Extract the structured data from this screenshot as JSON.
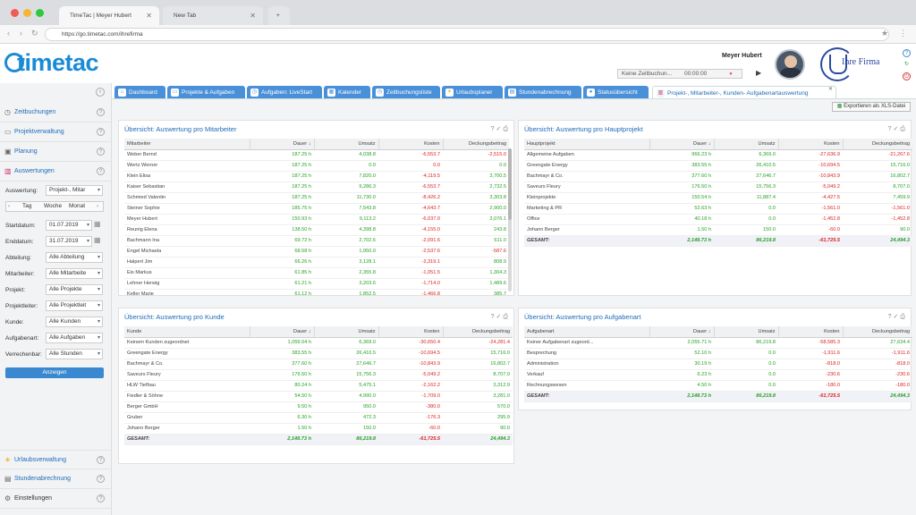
{
  "browser": {
    "tabs": [
      "TimeTac | Meyer Hubert",
      "New Tab"
    ],
    "url": "https://go.timetac.com/ihrefirma"
  },
  "header": {
    "logo": "timetac",
    "user_name": "Meyer Hubert",
    "tracker_text": "Keine Zeitbuchun...",
    "tracker_time": "00:00:00",
    "company_name": "Ihre Firma"
  },
  "sidebar": {
    "items": [
      {
        "label": "Zeitbuchungen",
        "icon": "clock-icon"
      },
      {
        "label": "Projektverwaltung",
        "icon": "folder-icon"
      },
      {
        "label": "Planung",
        "icon": "calendar-check-icon"
      },
      {
        "label": "Auswertungen",
        "icon": "bar-chart-icon"
      }
    ],
    "bottom_items": [
      {
        "label": "Urlaubsverwaltung",
        "icon": "sun-icon"
      },
      {
        "label": "Stundenabrechnung",
        "icon": "document-icon"
      },
      {
        "label": "Einstellungen",
        "icon": "gear-icon"
      }
    ],
    "filters": {
      "auswertung_label": "Auswertung:",
      "auswertung_value": "Projekt-, Mitar",
      "period_buttons": [
        "Tag",
        "Woche",
        "Monat"
      ],
      "startdatum_label": "Startdatum:",
      "startdatum_value": "01.07.2019",
      "enddatum_label": "Enddatum:",
      "enddatum_value": "31.07.2019",
      "abteilung_label": "Abteilung:",
      "abteilung_value": "Alle Abteilung",
      "mitarbeiter_label": "Mitarbeiter:",
      "mitarbeiter_value": "Alle Mitarbeite",
      "projekt_label": "Projekt:",
      "projekt_value": "Alle Projekte",
      "projektleiter_label": "Projektleiter:",
      "projektleiter_value": "Alle Projektleit",
      "kunde_label": "Kunde:",
      "kunde_value": "Alle Kunden",
      "aufgabenart_label": "Aufgabenart:",
      "aufgabenart_value": "Alle Aufgaben",
      "verrechenbar_label": "Verrechenbar:",
      "verrechenbar_value": "Alle Stunden",
      "anzeigen_label": "Anzeigen"
    }
  },
  "tabs": [
    {
      "label": "Dashboard"
    },
    {
      "label": "Projekte & Aufgaben"
    },
    {
      "label": "Aufgaben: LiveStart"
    },
    {
      "label": "Kalender"
    },
    {
      "label": "Zeitbuchungsliste"
    },
    {
      "label": "Urlaubsplaner"
    },
    {
      "label": "Stundenabrechnung"
    },
    {
      "label": "Statusübersicht"
    },
    {
      "label": "Projekt-, Mitarbeiter-, Kunden- Aufgabenartauswertung"
    }
  ],
  "export_label": "Exportieren als XLS-Datei",
  "panels": {
    "mitarbeiter": {
      "title": "Übersicht: Auswertung pro Mitarbeiter",
      "headers": [
        "Mitarbeiter",
        "Dauer ↓",
        "Umsatz",
        "Kosten",
        "Deckungsbeitrag"
      ],
      "rows": [
        [
          "Weber Bernd",
          "187.25 h",
          "4,038.8",
          "-6,553.7",
          "-2,515.0"
        ],
        [
          "Wertz Werner",
          "187.25 h",
          "0.0",
          "0.0",
          "0.0"
        ],
        [
          "Klein Elisa",
          "187.25 h",
          "7,820.0",
          "-4,119.5",
          "3,700.5"
        ],
        [
          "Kaiser Sebastian",
          "187.25 h",
          "9,286.3",
          "-6,553.7",
          "2,732.5"
        ],
        [
          "Schmied Valentin",
          "187.25 h",
          "11,730.0",
          "-8,426.2",
          "3,303.8"
        ],
        [
          "Steiner Sophie",
          "185.75 h",
          "7,543.8",
          "-4,643.7",
          "2,900.0"
        ],
        [
          "Meyer Hubert",
          "150.93 h",
          "9,113.2",
          "-6,037.0",
          "3,076.1"
        ],
        [
          "Reunig Elena",
          "138.50 h",
          "4,398.8",
          "-4,155.0",
          "243.8"
        ],
        [
          "Bachmann Ina",
          "69.72 h",
          "2,702.6",
          "-2,091.6",
          "611.0"
        ],
        [
          "Engel Michaela",
          "68.58 h",
          "1,950.0",
          "-2,537.6",
          "-587.6"
        ],
        [
          "Halpert Jim",
          "66.26 h",
          "3,128.1",
          "-2,319.1",
          "808.9"
        ],
        [
          "Eis Markus",
          "61.85 h",
          "2,355.8",
          "-1,051.5",
          "1,304.3"
        ],
        [
          "Lehner Herwig",
          "61.21 h",
          "3,203.6",
          "-1,714.0",
          "1,489.6"
        ],
        [
          "Keller Marie",
          "61.12 h",
          "1,852.5",
          "-1,466.8",
          "385.7"
        ]
      ]
    },
    "hauptprojekt": {
      "title": "Übersicht: Auswertung pro Hauptprojekt",
      "headers": [
        "Hauptprojekt",
        "Dauer ↓",
        "Umsatz",
        "Kosten",
        "Deckungsbeitrag"
      ],
      "rows": [
        [
          "Allgemeine Aufgaben",
          "966.23 h",
          "6,369.0",
          "-27,636.9",
          "-21,267.6"
        ],
        [
          "Greengate Energy",
          "383.55 h",
          "26,410.5",
          "-10,694.5",
          "15,716.0"
        ],
        [
          "Bachmayr & Co.",
          "377.60 h",
          "27,646.7",
          "-10,843.9",
          "16,802.7"
        ],
        [
          "Saveurs Fleury",
          "176.50 h",
          "15,756.3",
          "-5,049.2",
          "8,707.0"
        ],
        [
          "Kleinprojekte",
          "150.54 h",
          "11,887.4",
          "-4,427.5",
          "7,459.9"
        ],
        [
          "Marketing & PR",
          "52.63 h",
          "0.0",
          "-1,561.0",
          "-1,561.0"
        ],
        [
          "Office",
          "40.18 h",
          "0.0",
          "-1,452.8",
          "-1,452.8"
        ],
        [
          "Johann Berger",
          "1.50 h",
          "150.0",
          "-60.0",
          "90.0"
        ]
      ],
      "total": [
        "GESAMT:",
        "2,148.73 h",
        "86,219.8",
        "-61,725.5",
        "24,494.3"
      ]
    },
    "kunde": {
      "title": "Übersicht: Auswertung pro Kunde",
      "headers": [
        "Kunde",
        "Dauer ↓",
        "Umsatz",
        "Kosten",
        "Deckungsbeitrag"
      ],
      "rows": [
        [
          "Keinem Kunden zugeordnet",
          "1,059.04 h",
          "6,369.0",
          "-30,650.4",
          "-24,281.4"
        ],
        [
          "Greengate Energy",
          "383.55 h",
          "26,410.5",
          "-10,694.5",
          "15,716.0"
        ],
        [
          "Bachmayr & Co.",
          "377.60 h",
          "27,646.7",
          "-10,843.9",
          "16,802.7"
        ],
        [
          "Saveurs Fleury",
          "176.50 h",
          "15,756.3",
          "-5,049.2",
          "8,707.0"
        ],
        [
          "HLW Tiefbau",
          "80.24 h",
          "5,475.1",
          "-2,162.2",
          "3,312.9"
        ],
        [
          "Fiedler & Söhne",
          "54.50 h",
          "4,990.0",
          "-1,709.0",
          "3,281.0"
        ],
        [
          "Berger GmbH",
          "9.50 h",
          "950.0",
          "-380.0",
          "570.0"
        ],
        [
          "Gruber",
          "6.30 h",
          "472.3",
          "-176.3",
          "295.9"
        ],
        [
          "Johann Berger",
          "1.50 h",
          "150.0",
          "-60.0",
          "90.0"
        ]
      ],
      "total": [
        "GESAMT:",
        "2,148.73 h",
        "86,219.8",
        "-61,725.5",
        "24,494.3"
      ]
    },
    "aufgabenart": {
      "title": "Übersicht: Auswertung pro Aufgabenart",
      "headers": [
        "Aufgabenart",
        "Dauer ↓",
        "Umsatz",
        "Kosten",
        "Deckungsbeitrag"
      ],
      "rows": [
        [
          "Keiner Aufgabenart zugeord...",
          "2,055.71 h",
          "86,219.8",
          "-58,585.3",
          "27,634.4"
        ],
        [
          "Besprechung",
          "52.10 h",
          "0.0",
          "-1,911.6",
          "-1,911.6"
        ],
        [
          "Administration",
          "30.19 h",
          "0.0",
          "-818.0",
          "-818.0"
        ],
        [
          "Verkauf",
          "6.23 h",
          "0.0",
          "-230.6",
          "-230.6"
        ],
        [
          "Rechnungswesen",
          "4.50 h",
          "0.0",
          "-180.0",
          "-180.0"
        ]
      ],
      "total": [
        "GESAMT:",
        "2,148.73 h",
        "86,219.8",
        "-61,725.5",
        "24,494.3"
      ]
    }
  }
}
